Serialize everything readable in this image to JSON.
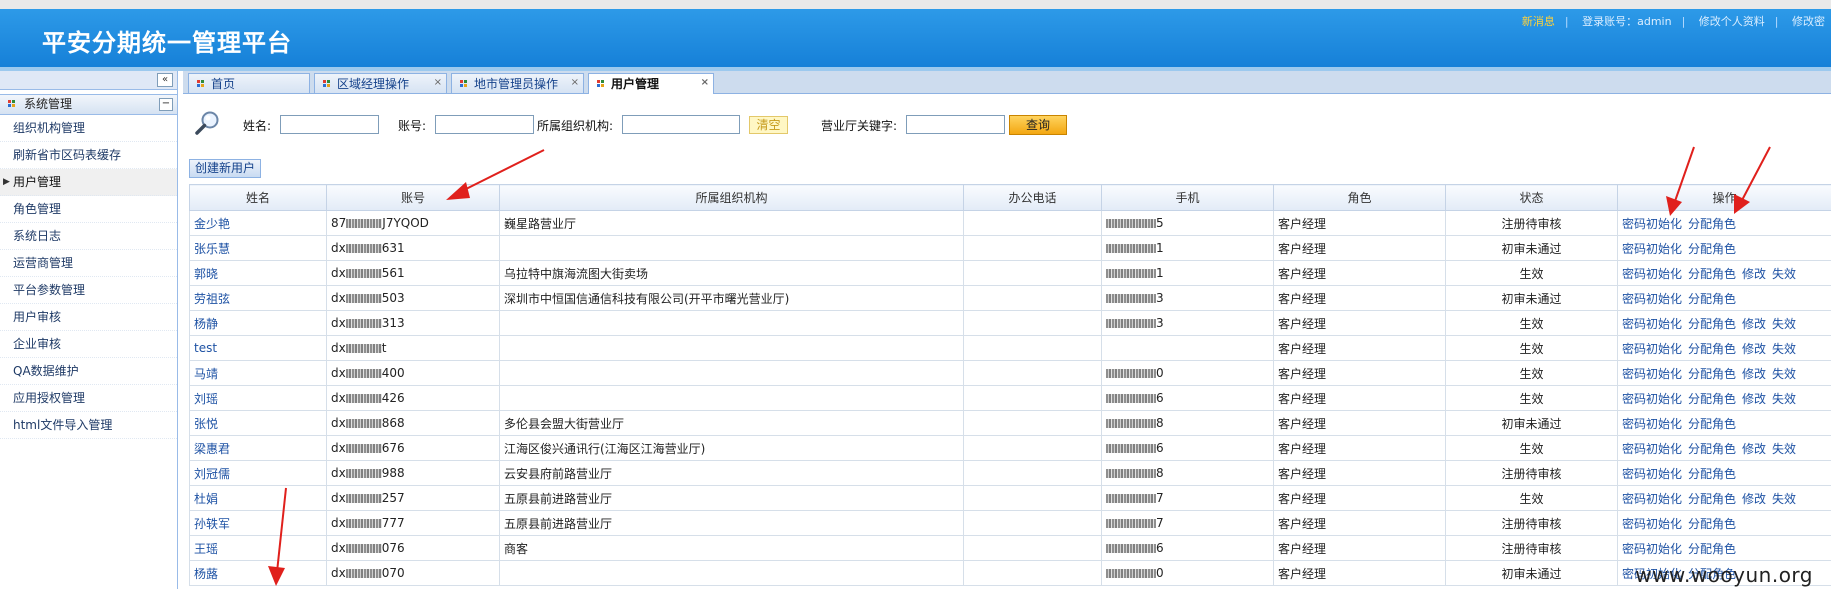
{
  "header": {
    "title": "平安分期统一管理平台",
    "new_message": "新消息",
    "login_account": "登录账号：admin",
    "edit_profile": "修改个人资料",
    "change_password": "修改密"
  },
  "sidebar": {
    "collapse_glyph": "«",
    "group_title": "系统管理",
    "group_toggle": "−",
    "active_marker": "▶",
    "items": [
      {
        "label": "组织机构管理"
      },
      {
        "label": "刷新省市区码表缓存"
      },
      {
        "label": "用户管理"
      },
      {
        "label": "角色管理"
      },
      {
        "label": "系统日志"
      },
      {
        "label": "运营商管理"
      },
      {
        "label": "平台参数管理"
      },
      {
        "label": "用户审核"
      },
      {
        "label": "企业审核"
      },
      {
        "label": "QA数据维护"
      },
      {
        "label": "应用授权管理"
      },
      {
        "label": "html文件导入管理"
      }
    ],
    "active_index": 2
  },
  "tabs": [
    {
      "label": "首页",
      "closable": false
    },
    {
      "label": "区域经理操作",
      "closable": true
    },
    {
      "label": "地市管理员操作",
      "closable": true
    },
    {
      "label": "用户管理",
      "closable": true,
      "active": true
    }
  ],
  "tab_close_glyph": "×",
  "search": {
    "name_label": "姓名:",
    "account_label": "账号:",
    "org_label": "所属组织机构:",
    "clear_button": "清空",
    "hall_label": "营业厅关键字:",
    "query_button": "查询"
  },
  "create_button": "创建新用户",
  "table": {
    "columns": [
      "姓名",
      "账号",
      "所属组织机构",
      "办公电话",
      "手机",
      "角色",
      "状态",
      "操作"
    ],
    "rows": [
      {
        "name": "金少艳",
        "account_prefix": "87",
        "account_suffix": "J7YQOD",
        "org": "巍星路营业厅",
        "phone_suffix": "5",
        "role": "客户经理",
        "status": "注册待审核",
        "ops": [
          "密码初始化",
          "分配角色"
        ]
      },
      {
        "name": "张乐慧",
        "account_prefix": "dx",
        "account_suffix": "631",
        "org": "",
        "phone_suffix": "1",
        "role": "客户经理",
        "status": "初审未通过",
        "ops": [
          "密码初始化",
          "分配角色"
        ]
      },
      {
        "name": "郭晓",
        "account_prefix": "dx",
        "account_suffix": "561",
        "org": "乌拉特中旗海流图大街卖场",
        "phone_suffix": "1",
        "role": "客户经理",
        "status": "生效",
        "ops": [
          "密码初始化",
          "分配角色",
          "修改",
          "失效"
        ]
      },
      {
        "name": "劳祖弦",
        "account_prefix": "dx",
        "account_suffix": "503",
        "org": "深圳市中恒国信通信科技有限公司(开平市曙光营业厅)",
        "phone_suffix": "3",
        "role": "客户经理",
        "status": "初审未通过",
        "ops": [
          "密码初始化",
          "分配角色"
        ]
      },
      {
        "name": "杨静",
        "account_prefix": "dx",
        "account_suffix": "313",
        "org": "",
        "phone_suffix": "3",
        "role": "客户经理",
        "status": "生效",
        "ops": [
          "密码初始化",
          "分配角色",
          "修改",
          "失效"
        ]
      },
      {
        "name": "test",
        "account_prefix": "dx",
        "account_suffix": "t",
        "org": "",
        "phone_suffix": "",
        "role": "客户经理",
        "status": "生效",
        "ops": [
          "密码初始化",
          "分配角色",
          "修改",
          "失效"
        ]
      },
      {
        "name": "马靖",
        "account_prefix": "dx",
        "account_suffix": "400",
        "org": "",
        "phone_suffix": "0",
        "role": "客户经理",
        "status": "生效",
        "ops": [
          "密码初始化",
          "分配角色",
          "修改",
          "失效"
        ]
      },
      {
        "name": "刘瑶",
        "account_prefix": "dx",
        "account_suffix": "426",
        "org": "",
        "phone_suffix": "6",
        "role": "客户经理",
        "status": "生效",
        "ops": [
          "密码初始化",
          "分配角色",
          "修改",
          "失效"
        ]
      },
      {
        "name": "张悦",
        "account_prefix": "dx",
        "account_suffix": "868",
        "org": "多伦县会盟大街营业厅",
        "phone_suffix": "8",
        "role": "客户经理",
        "status": "初审未通过",
        "ops": [
          "密码初始化",
          "分配角色"
        ]
      },
      {
        "name": "梁惠君",
        "account_prefix": "dx",
        "account_suffix": "676",
        "org": "江海区俊兴通讯行(江海区江海营业厅)",
        "phone_suffix": "6",
        "role": "客户经理",
        "status": "生效",
        "ops": [
          "密码初始化",
          "分配角色",
          "修改",
          "失效"
        ]
      },
      {
        "name": "刘冠儒",
        "account_prefix": "dx",
        "account_suffix": "988",
        "org": "云安县府前路营业厅",
        "phone_suffix": "8",
        "role": "客户经理",
        "status": "注册待审核",
        "ops": [
          "密码初始化",
          "分配角色"
        ]
      },
      {
        "name": "杜娟",
        "account_prefix": "dx",
        "account_suffix": "257",
        "org": "五原县前进路营业厅",
        "phone_suffix": "7",
        "role": "客户经理",
        "status": "生效",
        "ops": [
          "密码初始化",
          "分配角色",
          "修改",
          "失效"
        ]
      },
      {
        "name": "孙轶军",
        "account_prefix": "dx",
        "account_suffix": "777",
        "org": "五原县前进路营业厅",
        "phone_suffix": "7",
        "role": "客户经理",
        "status": "注册待审核",
        "ops": [
          "密码初始化",
          "分配角色"
        ]
      },
      {
        "name": "王瑶",
        "account_prefix": "dx",
        "account_suffix": "076",
        "org": "商客",
        "phone_suffix": "6",
        "role": "客户经理",
        "status": "注册待审核",
        "ops": [
          "密码初始化",
          "分配角色"
        ]
      },
      {
        "name": "杨蕗",
        "account_prefix": "dx",
        "account_suffix": "070",
        "org": "",
        "phone_suffix": "0",
        "role": "客户经理",
        "status": "初审未通过",
        "ops": [
          "密码初始化",
          "分配角色"
        ]
      }
    ]
  },
  "watermark": "www.wooyun.org",
  "colors": {
    "header_blue": "#1a88dc",
    "link_blue": "#1e52a4",
    "annotation_red": "#e0201c"
  }
}
